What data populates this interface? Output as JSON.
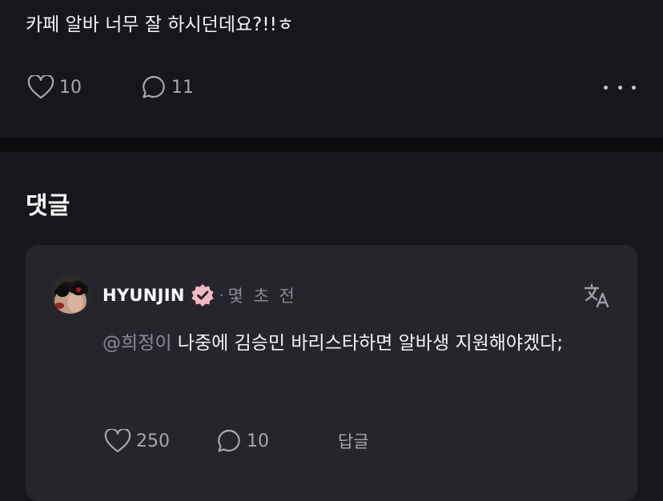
{
  "post": {
    "text": "카페 알바 너무 잘 하시던데요?!!ㅎ",
    "likes": "10",
    "comments": "11"
  },
  "comments_section": {
    "heading": "댓글"
  },
  "comment": {
    "username": "HYUNJIN",
    "separator": "·",
    "timestamp": "몇 초 전",
    "mention": "@희정이",
    "text": " 나중에 김승민 바리스타하면 알바생 지원해야겠다;",
    "likes": "250",
    "replies": "10",
    "reply_label": "답글"
  },
  "icons": {
    "like": "heart-icon",
    "comment": "speech-bubble-icon",
    "more": "more-dots-icon",
    "verified": "verified-badge-icon",
    "translate": "translate-icon"
  },
  "colors": {
    "background": "#17161b",
    "card": "#26252c",
    "muted_text": "#a8a7ad",
    "verified_badge": "#f3b8c4"
  }
}
